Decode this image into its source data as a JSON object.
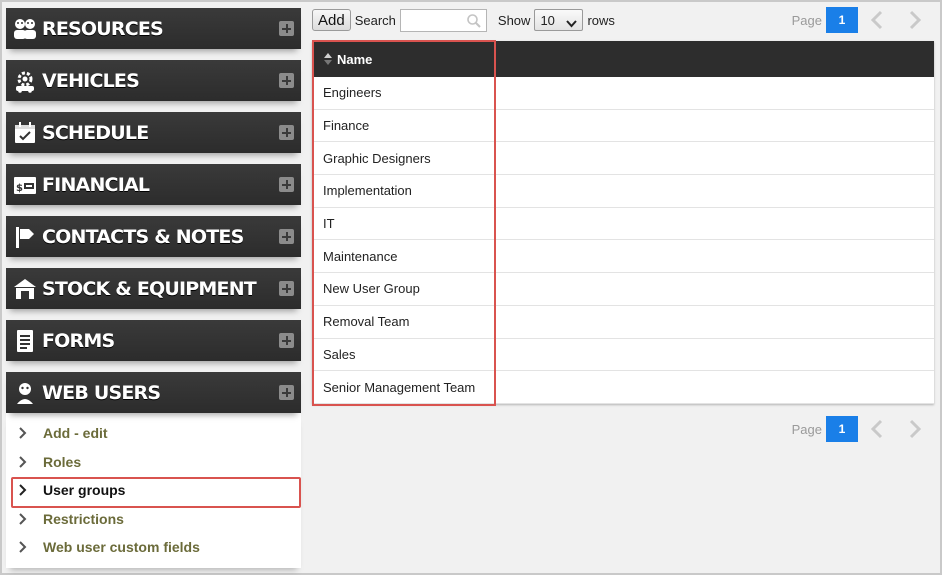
{
  "sidebar": {
    "sections": [
      {
        "label": "RESOURCES",
        "icon": "resources-icon"
      },
      {
        "label": "VEHICLES",
        "icon": "vehicles-icon"
      },
      {
        "label": "SCHEDULE",
        "icon": "schedule-icon"
      },
      {
        "label": "FINANCIAL",
        "icon": "financial-icon"
      },
      {
        "label": "CONTACTS & NOTES",
        "icon": "contacts-flag-icon"
      },
      {
        "label": "STOCK & EQUIPMENT",
        "icon": "stock-warehouse-icon"
      },
      {
        "label": "FORMS",
        "icon": "forms-document-icon"
      },
      {
        "label": "WEB USERS",
        "icon": "web-users-icon"
      }
    ],
    "web_users_items": [
      {
        "label": "Add - edit"
      },
      {
        "label": "Roles"
      },
      {
        "label": "User groups",
        "active": true
      },
      {
        "label": "Restrictions"
      },
      {
        "label": "Web user custom fields"
      }
    ],
    "highlight_color": "#d9534f"
  },
  "toolbar": {
    "add_label": "Add",
    "search_label": "Search",
    "search_value": "",
    "show_label": "Show",
    "rows_value": "10",
    "rows_label": "rows"
  },
  "pager": {
    "page_label": "Page",
    "current_page": "1",
    "accent": "#1a7fe8"
  },
  "table": {
    "column_header": "Name",
    "rows": [
      "Engineers",
      "Finance",
      "Graphic Designers",
      "Implementation",
      "IT",
      "Maintenance",
      "New User Group",
      "Removal Team",
      "Sales",
      "Senior Management Team"
    ]
  }
}
